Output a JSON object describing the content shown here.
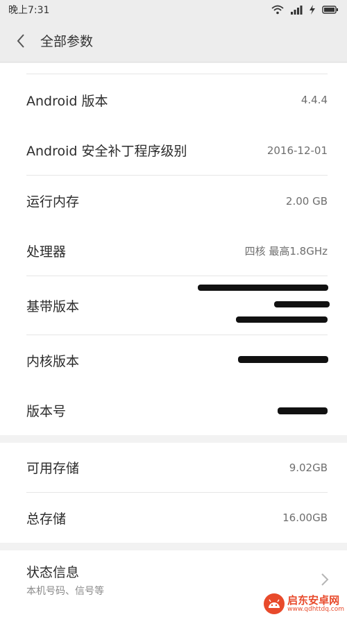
{
  "status_bar": {
    "time": "晚上7:31"
  },
  "header": {
    "title": "全部参数"
  },
  "group1": [
    {
      "label": "Android 版本",
      "value": "4.4.4"
    },
    {
      "label": "Android 安全补丁程序级别",
      "value": "2016-12-01"
    },
    {
      "label": "运行内存",
      "value": "2.00 GB"
    },
    {
      "label": "处理器",
      "value": "四核 最高1.8GHz"
    },
    {
      "label": "基带版本",
      "value": ""
    },
    {
      "label": "内核版本",
      "value": ""
    },
    {
      "label": "版本号",
      "value": ""
    }
  ],
  "group2": [
    {
      "label": "可用存储",
      "value": "9.02GB"
    },
    {
      "label": "总存储",
      "value": "16.00GB"
    }
  ],
  "status_info": {
    "title": "状态信息",
    "subtitle": "本机号码、信号等"
  },
  "watermark": {
    "name": "启东安卓网",
    "url": "www.qdhttdq.com"
  }
}
